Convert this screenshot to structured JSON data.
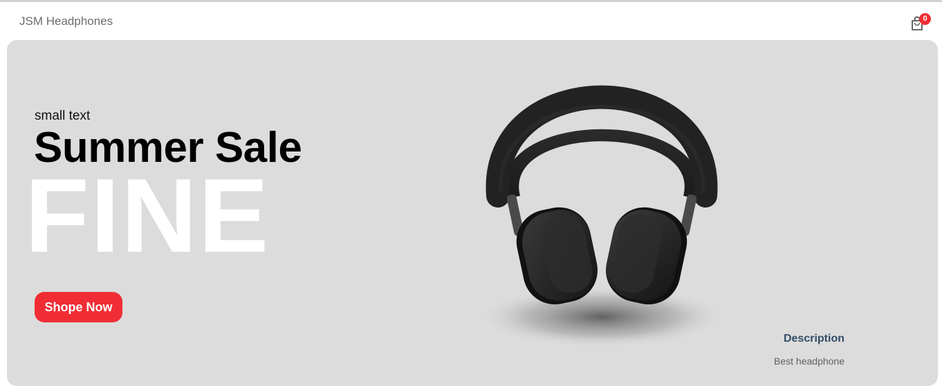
{
  "navbar": {
    "logo": "JSM Headphones",
    "cart_icon": "shopping-bag-icon",
    "cart_count": "0"
  },
  "hero": {
    "small_text": "small text",
    "mid_text": "Summer Sale",
    "large_text": "FINE",
    "button_label": "Shope Now",
    "product_image": "headphones",
    "description_title": "Description",
    "description_text": "Best headphone"
  },
  "colors": {
    "accent": "#f02d34",
    "hero_background": "#dcdcdc",
    "description_title": "#324d67",
    "large_text": "#ffffff"
  }
}
